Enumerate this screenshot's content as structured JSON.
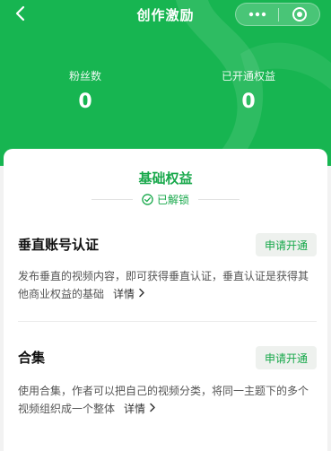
{
  "header": {
    "title": "创作激励",
    "back_icon": "chevron-left-icon",
    "more_icon": "more-dots-icon",
    "close_icon": "target-close-icon",
    "bg_color": "#17b551",
    "stats": [
      {
        "label": "粉丝数",
        "value": "0"
      },
      {
        "label": "已开通权益",
        "value": "0"
      }
    ]
  },
  "card": {
    "section_title": "基础权益",
    "unlock_label": "已解锁",
    "unlock_icon": "check-circle-icon",
    "accent_color": "#17a84a",
    "items": [
      {
        "title": "垂直账号认证",
        "button": "申请开通",
        "desc": "发布垂直的视频内容，即可获得垂直认证，垂直认证是获得其他商业权益的基础",
        "link": "详情",
        "link_icon": "chevron-right-icon"
      },
      {
        "title": "合集",
        "button": "申请开通",
        "desc": "使用合集，作者可以把自己的视频分类，将同一主题下的多个视频组织成一个整体",
        "link": "详情",
        "link_icon": "chevron-right-icon"
      }
    ]
  }
}
